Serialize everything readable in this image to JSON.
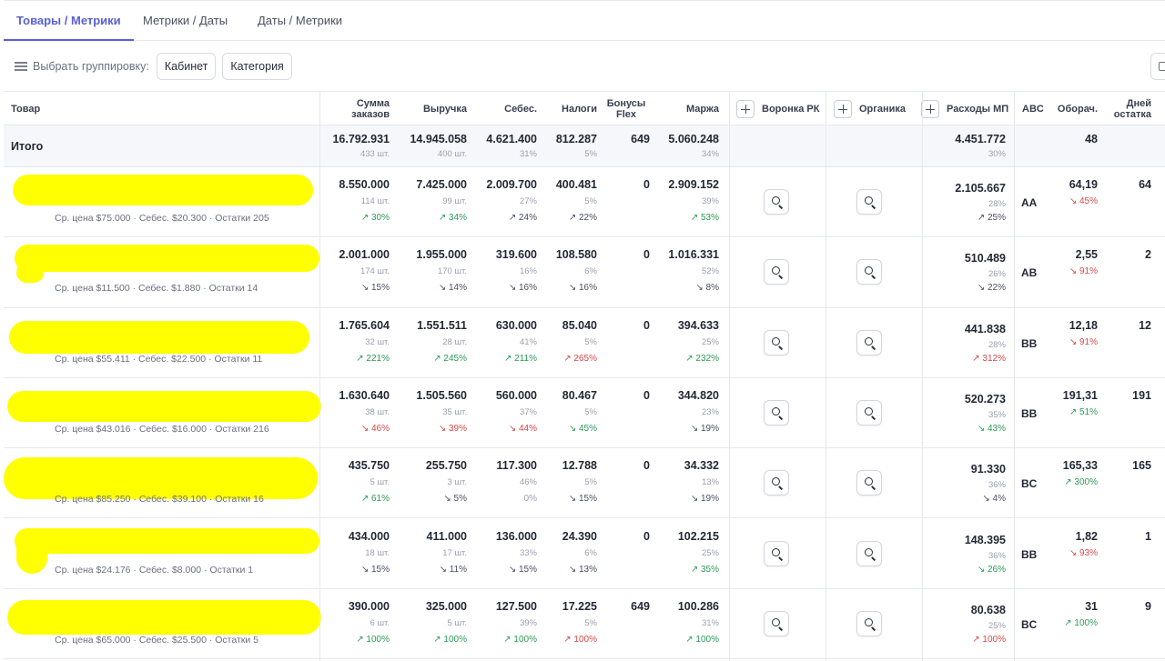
{
  "tabs": [
    {
      "label": "Товары / Метрики",
      "active": true
    },
    {
      "label": "Метрики / Даты",
      "active": false
    },
    {
      "label": "Даты / Метрики",
      "active": false
    }
  ],
  "grouping": {
    "label": "Выбрать группировку:",
    "chips": [
      "Кабинет",
      "Категория"
    ]
  },
  "columns": {
    "product": "Товар",
    "orders": "Сумма\nзаказов",
    "revenue": "Выручка",
    "cost": "Себес.",
    "taxes": "Налоги",
    "bonus": "Бонусы\nFlex",
    "margin": "Маржа",
    "funnel": "Воронка РК",
    "organic": "Органика",
    "mp_expenses": "Расходы МП",
    "abc": "ABC",
    "turnover": "Оборач.",
    "days": "Дней\nостатка"
  },
  "total": {
    "label": "Итого",
    "orders": "16.792.931",
    "orders_sub": "433 шт.",
    "revenue": "14.945.058",
    "revenue_sub": "400 шт.",
    "cost": "4.621.400",
    "cost_sub": "31%",
    "taxes": "812.287",
    "taxes_sub": "5%",
    "bonus": "649",
    "margin": "5.060.248",
    "margin_sub": "34%",
    "mp": "4.451.772",
    "mp_sub": "30%",
    "turnover": "48"
  },
  "rows": [
    {
      "meta": "Ср. цена $75.000 · Себес. $20.300 · Остатки 205",
      "orders": "8.550.000",
      "orders_sub": "114 шт.",
      "orders_d": "↗ 30%",
      "orders_t": "up",
      "revenue": "7.425.000",
      "revenue_sub": "99 шт.",
      "revenue_d": "↗ 34%",
      "revenue_t": "up",
      "cost": "2.009.700",
      "cost_sub": "27%",
      "cost_d": "↗ 24%",
      "cost_t": "neutral",
      "taxes": "400.481",
      "taxes_sub": "5%",
      "taxes_d": "↗ 22%",
      "taxes_t": "neutral",
      "bonus": "0",
      "margin": "2.909.152",
      "margin_sub": "39%",
      "margin_d": "↗ 53%",
      "margin_t": "up",
      "mp": "2.105.667",
      "mp_sub": "28%",
      "mp_d": "↗ 25%",
      "mp_t": "neutral",
      "abc": "AA",
      "turnover": "64,19",
      "turnover_d": "↘ 45%",
      "turnover_t": "down",
      "days": "64"
    },
    {
      "meta": "Ср. цена $11.500 · Себес. $1.880 · Остатки 14",
      "orders": "2.001.000",
      "orders_sub": "174 шт.",
      "orders_d": "↘ 15%",
      "orders_t": "neutral",
      "revenue": "1.955.000",
      "revenue_sub": "170 шт.",
      "revenue_d": "↘ 14%",
      "revenue_t": "neutral",
      "cost": "319.600",
      "cost_sub": "16%",
      "cost_d": "↘ 16%",
      "cost_t": "neutral",
      "taxes": "108.580",
      "taxes_sub": "6%",
      "taxes_d": "↘ 16%",
      "taxes_t": "neutral",
      "bonus": "0",
      "margin": "1.016.331",
      "margin_sub": "52%",
      "margin_d": "↘ 8%",
      "margin_t": "neutral",
      "mp": "510.489",
      "mp_sub": "26%",
      "mp_d": "↘ 22%",
      "mp_t": "neutral",
      "abc": "AB",
      "turnover": "2,55",
      "turnover_d": "↘ 91%",
      "turnover_t": "down",
      "days": "2"
    },
    {
      "meta": "Ср. цена $55.411 · Себес. $22.500 · Остатки 11",
      "orders": "1.765.604",
      "orders_sub": "32 шт.",
      "orders_d": "↗ 221%",
      "orders_t": "up",
      "revenue": "1.551.511",
      "revenue_sub": "28 шт.",
      "revenue_d": "↗ 245%",
      "revenue_t": "up",
      "cost": "630.000",
      "cost_sub": "41%",
      "cost_d": "↗ 211%",
      "cost_t": "up",
      "taxes": "85.040",
      "taxes_sub": "5%",
      "taxes_d": "↗ 265%",
      "taxes_t": "down",
      "bonus": "0",
      "margin": "394.633",
      "margin_sub": "25%",
      "margin_d": "↗ 232%",
      "margin_t": "up",
      "mp": "441.838",
      "mp_sub": "28%",
      "mp_d": "↗ 312%",
      "mp_t": "down",
      "abc": "BB",
      "turnover": "12,18",
      "turnover_d": "↘ 91%",
      "turnover_t": "down",
      "days": "12"
    },
    {
      "meta": "Ср. цена $43.016 · Себес. $16.000 · Остатки 216",
      "orders": "1.630.640",
      "orders_sub": "38 шт.",
      "orders_d": "↘ 46%",
      "orders_t": "down",
      "revenue": "1.505.560",
      "revenue_sub": "35 шт.",
      "revenue_d": "↘ 39%",
      "revenue_t": "down",
      "cost": "560.000",
      "cost_sub": "37%",
      "cost_d": "↘ 44%",
      "cost_t": "down",
      "taxes": "80.467",
      "taxes_sub": "5%",
      "taxes_d": "↘ 45%",
      "taxes_t": "up",
      "bonus": "0",
      "margin": "344.820",
      "margin_sub": "23%",
      "margin_d": "↘ 19%",
      "margin_t": "neutral",
      "mp": "520.273",
      "mp_sub": "35%",
      "mp_d": "↘ 43%",
      "mp_t": "up",
      "abc": "BB",
      "turnover": "191,31",
      "turnover_d": "↗ 51%",
      "turnover_t": "up",
      "days": "191"
    },
    {
      "meta": "Ср. цена $85.250 · Себес. $39.100 · Остатки 16",
      "orders": "435.750",
      "orders_sub": "5 шт.",
      "orders_d": "↗ 61%",
      "orders_t": "up",
      "revenue": "255.750",
      "revenue_sub": "3 шт.",
      "revenue_d": "↘ 5%",
      "revenue_t": "neutral",
      "cost": "117.300",
      "cost_sub": "46%",
      "cost_d": "0%",
      "cost_t": "zero",
      "taxes": "12.788",
      "taxes_sub": "5%",
      "taxes_d": "↘ 15%",
      "taxes_t": "neutral",
      "bonus": "0",
      "margin": "34.332",
      "margin_sub": "13%",
      "margin_d": "↘ 19%",
      "margin_t": "neutral",
      "mp": "91.330",
      "mp_sub": "36%",
      "mp_d": "↘ 4%",
      "mp_t": "neutral",
      "abc": "BC",
      "turnover": "165,33",
      "turnover_d": "↗ 300%",
      "turnover_t": "up",
      "days": "165"
    },
    {
      "meta": "Ср. цена $24.176 · Себес. $8.000 · Остатки 1",
      "orders": "434.000",
      "orders_sub": "18 шт.",
      "orders_d": "↘ 15%",
      "orders_t": "neutral",
      "revenue": "411.000",
      "revenue_sub": "17 шт.",
      "revenue_d": "↘ 11%",
      "revenue_t": "neutral",
      "cost": "136.000",
      "cost_sub": "33%",
      "cost_d": "↘ 15%",
      "cost_t": "neutral",
      "taxes": "24.390",
      "taxes_sub": "6%",
      "taxes_d": "↘ 13%",
      "taxes_t": "neutral",
      "bonus": "0",
      "margin": "102.215",
      "margin_sub": "25%",
      "margin_d": "↗ 35%",
      "margin_t": "up",
      "mp": "148.395",
      "mp_sub": "36%",
      "mp_d": "↘ 26%",
      "mp_t": "up",
      "abc": "BB",
      "turnover": "1,82",
      "turnover_d": "↘ 93%",
      "turnover_t": "down",
      "days": "1"
    },
    {
      "meta": "Ср. цена $65.000 · Себес. $25.500 · Остатки 5",
      "orders": "390.000",
      "orders_sub": "6 шт.",
      "orders_d": "↗ 100%",
      "orders_t": "up",
      "revenue": "325.000",
      "revenue_sub": "5 шт.",
      "revenue_d": "↗ 100%",
      "revenue_t": "up",
      "cost": "127.500",
      "cost_sub": "39%",
      "cost_d": "↗ 100%",
      "cost_t": "up",
      "taxes": "17.225",
      "taxes_sub": "5%",
      "taxes_d": "↗ 100%",
      "taxes_t": "down",
      "bonus": "649",
      "margin": "100.286",
      "margin_sub": "31%",
      "margin_d": "↗ 100%",
      "margin_t": "up",
      "mp": "80.638",
      "mp_sub": "25%",
      "mp_d": "↗ 100%",
      "mp_t": "down",
      "abc": "BC",
      "turnover": "31",
      "turnover_d": "↗ 100%",
      "turnover_t": "up",
      "days": "9"
    }
  ],
  "colors": {
    "accent": "#5b5fd6",
    "up": "#2b9a55",
    "down": "#d94848",
    "redaction": "#ffff00"
  }
}
